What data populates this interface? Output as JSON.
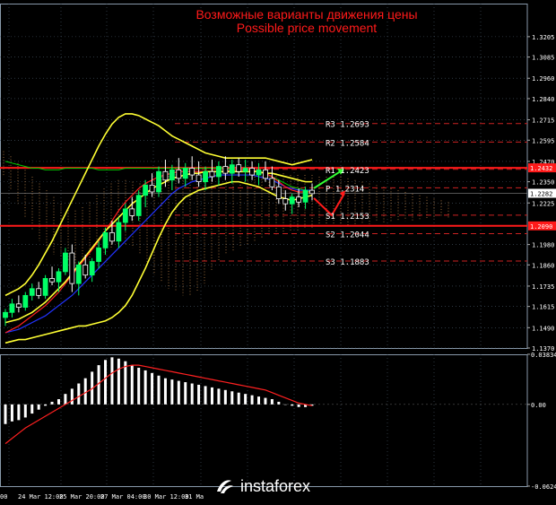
{
  "title_ru": "Возможные варианты движения цены",
  "title_en": "Possible price movement",
  "logo_text": "instaforex",
  "colors": {
    "background": "#000000",
    "grid": "#4a5a6a",
    "candle_up": "#00ff66",
    "candle_down": "#ffffff",
    "bollinger": "#ffff33",
    "ma_red": "#ff2020",
    "ma_blue": "#2233ff",
    "ma_green": "#00cc00",
    "kumo": "#ffb060",
    "support_resistance": "#ff1a1a",
    "pivot_text": "#ffffff",
    "macd_hist": "#ffffff",
    "macd_signal": "#ff2020",
    "arrow_up": "#33ff33",
    "arrow_down": "#ff1a1a"
  },
  "chart_data": [
    {
      "type": "candlestick",
      "ylim": [
        1.137,
        1.34
      ],
      "price_ticks": [
        "1.3205",
        "1.3085",
        "1.2960",
        "1.2840",
        "1.2715",
        "1.2595",
        "1.2470",
        "1.2350",
        "1.2225",
        "1.1980",
        "1.1860",
        "1.1735",
        "1.1615",
        "1.1490",
        "1.1370"
      ],
      "x_labels": [
        "00",
        "24 Mar 12:00",
        "25 Mar 20:00",
        "27 Mar 04:00",
        "30 Mar 12:00",
        "31 Ma"
      ],
      "current_price": "1.2282",
      "resistance_level": "1.2432",
      "support_level": "1.2090",
      "pivots": [
        {
          "label": "R3",
          "value": "1.2693"
        },
        {
          "label": "R2",
          "value": "1.2584"
        },
        {
          "label": "R1",
          "value": "1.2423"
        },
        {
          "label": "P",
          "value": "1.2314"
        },
        {
          "label": "S1",
          "value": "1.2153"
        },
        {
          "label": "S2",
          "value": "1.2044"
        },
        {
          "label": "S3",
          "value": "1.1883"
        }
      ],
      "candles": [
        [
          1.155,
          1.16,
          1.15,
          1.158
        ],
        [
          1.158,
          1.166,
          1.155,
          1.163
        ],
        [
          1.163,
          1.168,
          1.158,
          1.161
        ],
        [
          1.161,
          1.17,
          1.159,
          1.168
        ],
        [
          1.168,
          1.175,
          1.165,
          1.172
        ],
        [
          1.172,
          1.176,
          1.166,
          1.168
        ],
        [
          1.168,
          1.18,
          1.166,
          1.178
        ],
        [
          1.178,
          1.185,
          1.174,
          1.176
        ],
        [
          1.176,
          1.184,
          1.17,
          1.182
        ],
        [
          1.182,
          1.196,
          1.18,
          1.193
        ],
        [
          1.193,
          1.198,
          1.17,
          1.175
        ],
        [
          1.175,
          1.188,
          1.168,
          1.186
        ],
        [
          1.186,
          1.192,
          1.178,
          1.18
        ],
        [
          1.18,
          1.19,
          1.176,
          1.188
        ],
        [
          1.188,
          1.2,
          1.184,
          1.196
        ],
        [
          1.196,
          1.208,
          1.192,
          1.205
        ],
        [
          1.205,
          1.212,
          1.198,
          1.2
        ],
        [
          1.2,
          1.214,
          1.196,
          1.211
        ],
        [
          1.211,
          1.222,
          1.206,
          1.219
        ],
        [
          1.219,
          1.226,
          1.212,
          1.215
        ],
        [
          1.215,
          1.23,
          1.212,
          1.227
        ],
        [
          1.227,
          1.236,
          1.22,
          1.233
        ],
        [
          1.233,
          1.24,
          1.226,
          1.229
        ],
        [
          1.229,
          1.244,
          1.226,
          1.241
        ],
        [
          1.241,
          1.248,
          1.232,
          1.236
        ],
        [
          1.236,
          1.245,
          1.23,
          1.242
        ],
        [
          1.242,
          1.249,
          1.234,
          1.237
        ],
        [
          1.237,
          1.246,
          1.232,
          1.243
        ],
        [
          1.243,
          1.25,
          1.236,
          1.239
        ],
        [
          1.239,
          1.247,
          1.232,
          1.235
        ],
        [
          1.235,
          1.244,
          1.23,
          1.241
        ],
        [
          1.241,
          1.248,
          1.235,
          1.238
        ],
        [
          1.238,
          1.247,
          1.233,
          1.244
        ],
        [
          1.244,
          1.25,
          1.236,
          1.24
        ],
        [
          1.24,
          1.248,
          1.234,
          1.245
        ],
        [
          1.245,
          1.249,
          1.238,
          1.241
        ],
        [
          1.241,
          1.248,
          1.235,
          1.243
        ],
        [
          1.243,
          1.247,
          1.236,
          1.239
        ],
        [
          1.239,
          1.246,
          1.233,
          1.242
        ],
        [
          1.242,
          1.247,
          1.235,
          1.237
        ],
        [
          1.237,
          1.244,
          1.23,
          1.232
        ],
        [
          1.232,
          1.236,
          1.222,
          1.225
        ],
        [
          1.225,
          1.23,
          1.218,
          1.222
        ],
        [
          1.222,
          1.228,
          1.216,
          1.226
        ],
        [
          1.226,
          1.231,
          1.22,
          1.223
        ],
        [
          1.223,
          1.232,
          1.219,
          1.23
        ],
        [
          1.23,
          1.234,
          1.224,
          1.228
        ]
      ],
      "macd": {
        "ticks": [
          "0.03834",
          "0.00",
          "-0.06247"
        ],
        "ylim": [
          -0.0625,
          0.0383
        ],
        "histogram": [
          -0.015,
          -0.013,
          -0.012,
          -0.01,
          -0.007,
          -0.004,
          -0.001,
          0.002,
          0.004,
          0.008,
          0.012,
          0.016,
          0.02,
          0.025,
          0.03,
          0.034,
          0.036,
          0.035,
          0.033,
          0.03,
          0.028,
          0.026,
          0.024,
          0.022,
          0.02,
          0.019,
          0.018,
          0.017,
          0.016,
          0.015,
          0.014,
          0.013,
          0.012,
          0.011,
          0.01,
          0.009,
          0.008,
          0.007,
          0.006,
          0.005,
          0.004,
          0.002,
          0.0,
          -0.001,
          -0.002,
          -0.002,
          -0.001
        ],
        "signal": [
          -0.03,
          -0.026,
          -0.022,
          -0.018,
          -0.015,
          -0.012,
          -0.009,
          -0.006,
          -0.003,
          0.0,
          0.003,
          0.006,
          0.009,
          0.012,
          0.016,
          0.02,
          0.024,
          0.027,
          0.029,
          0.03,
          0.03,
          0.029,
          0.028,
          0.027,
          0.026,
          0.025,
          0.024,
          0.023,
          0.022,
          0.021,
          0.02,
          0.019,
          0.018,
          0.017,
          0.016,
          0.015,
          0.014,
          0.013,
          0.012,
          0.011,
          0.009,
          0.007,
          0.005,
          0.003,
          0.001,
          0.0,
          -0.001
        ]
      }
    }
  ]
}
